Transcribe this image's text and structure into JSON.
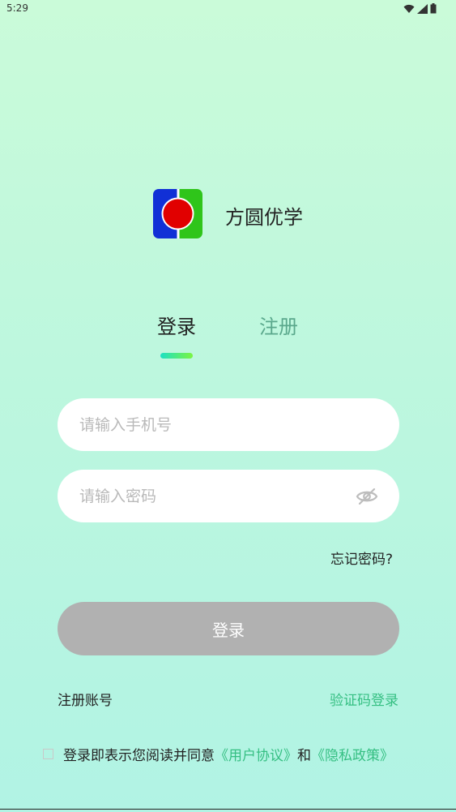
{
  "status_bar": {
    "time": "5:29"
  },
  "app": {
    "name": "方圆优学",
    "logo_icon": "app-logo-icon"
  },
  "tabs": {
    "login_label": "登录",
    "register_label": "注册"
  },
  "form": {
    "phone_placeholder": "请输入手机号",
    "password_placeholder": "请输入密码",
    "forgot_password": "忘记密码?",
    "login_button": "登录"
  },
  "links": {
    "register_account": "注册账号",
    "sms_login": "验证码登录"
  },
  "agreement": {
    "prefix": "登录即表示您阅读并同意",
    "user_agreement": "《用户协议》",
    "and": "和",
    "privacy_policy": "《隐私政策》"
  },
  "colors": {
    "accent": "#35bf82",
    "tab_inactive": "#5aa88c",
    "button_disabled": "#b1b1b1",
    "logo_blue": "#1130d6",
    "logo_green": "#2fc51a",
    "logo_red": "#e10000"
  }
}
